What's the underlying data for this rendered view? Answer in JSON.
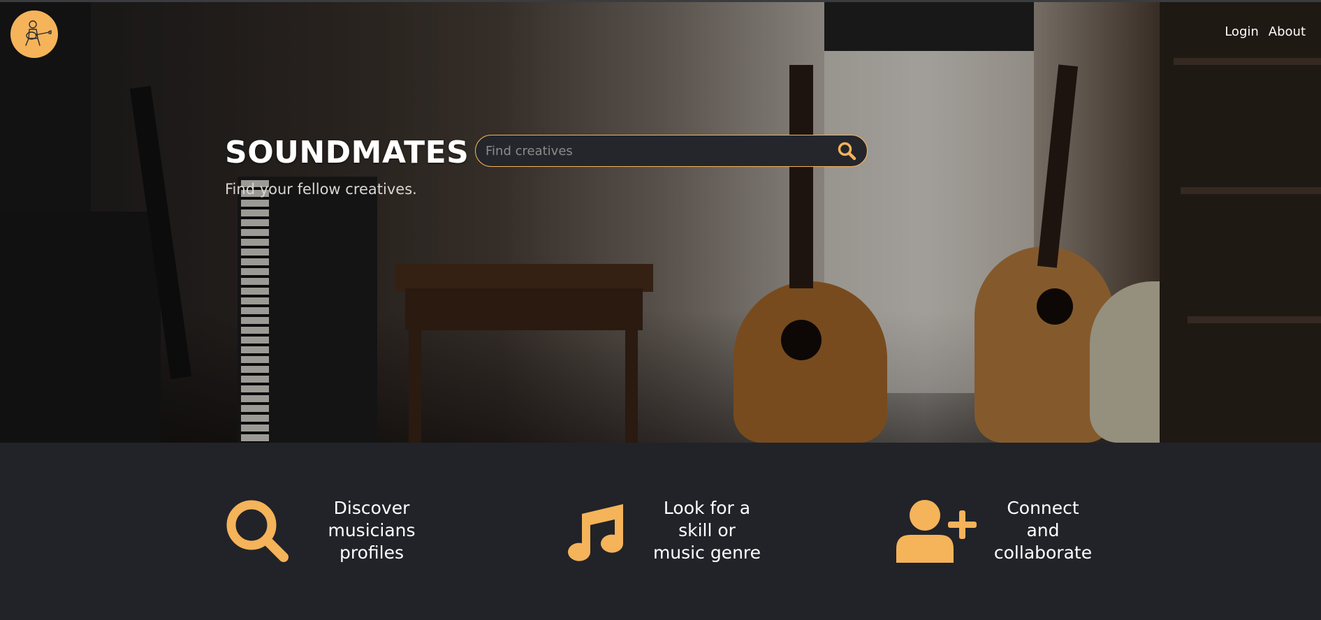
{
  "app": {
    "brand": "SOUNDMATES",
    "tagline": "Find your fellow creatives."
  },
  "nav": {
    "login": "Login",
    "about": "About"
  },
  "search": {
    "placeholder": "Find creatives",
    "value": ""
  },
  "features": [
    {
      "icon": "search-icon",
      "text": "Discover\nmusicians\nprofiles"
    },
    {
      "icon": "music-note-icon",
      "text": "Look for a\nskill or\nmusic genre"
    },
    {
      "icon": "add-user-icon",
      "text": "Connect\nand\ncollaborate"
    }
  ],
  "colors": {
    "accent": "#f5b35a",
    "dark_bg": "#212328"
  }
}
